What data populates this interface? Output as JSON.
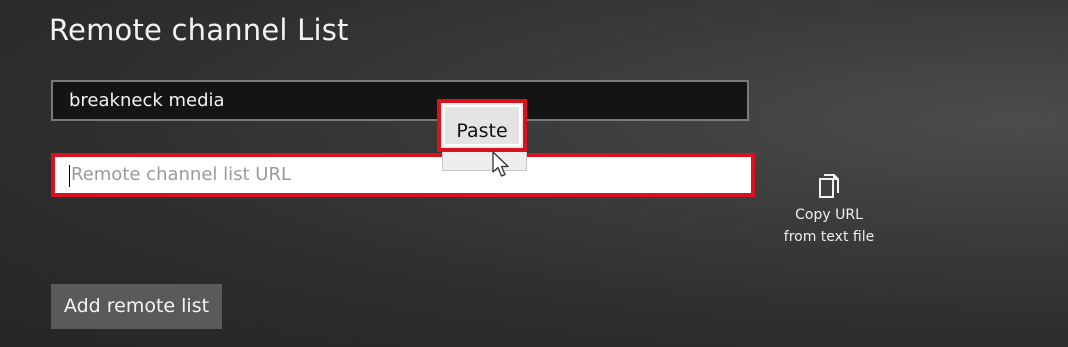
{
  "page": {
    "title": "Remote channel List"
  },
  "form": {
    "name_value": "breakneck media",
    "url_placeholder": "Remote channel list URL",
    "url_value": ""
  },
  "context_menu": {
    "paste_label": "Paste"
  },
  "copy_url": {
    "label": "Copy URL from text file",
    "icon": "copy-file-icon"
  },
  "actions": {
    "add_remote_list_label": "Add remote list"
  },
  "colors": {
    "highlight": "#d7131f",
    "field_dark": "#141414",
    "button_bg": "#5a5a5a"
  }
}
